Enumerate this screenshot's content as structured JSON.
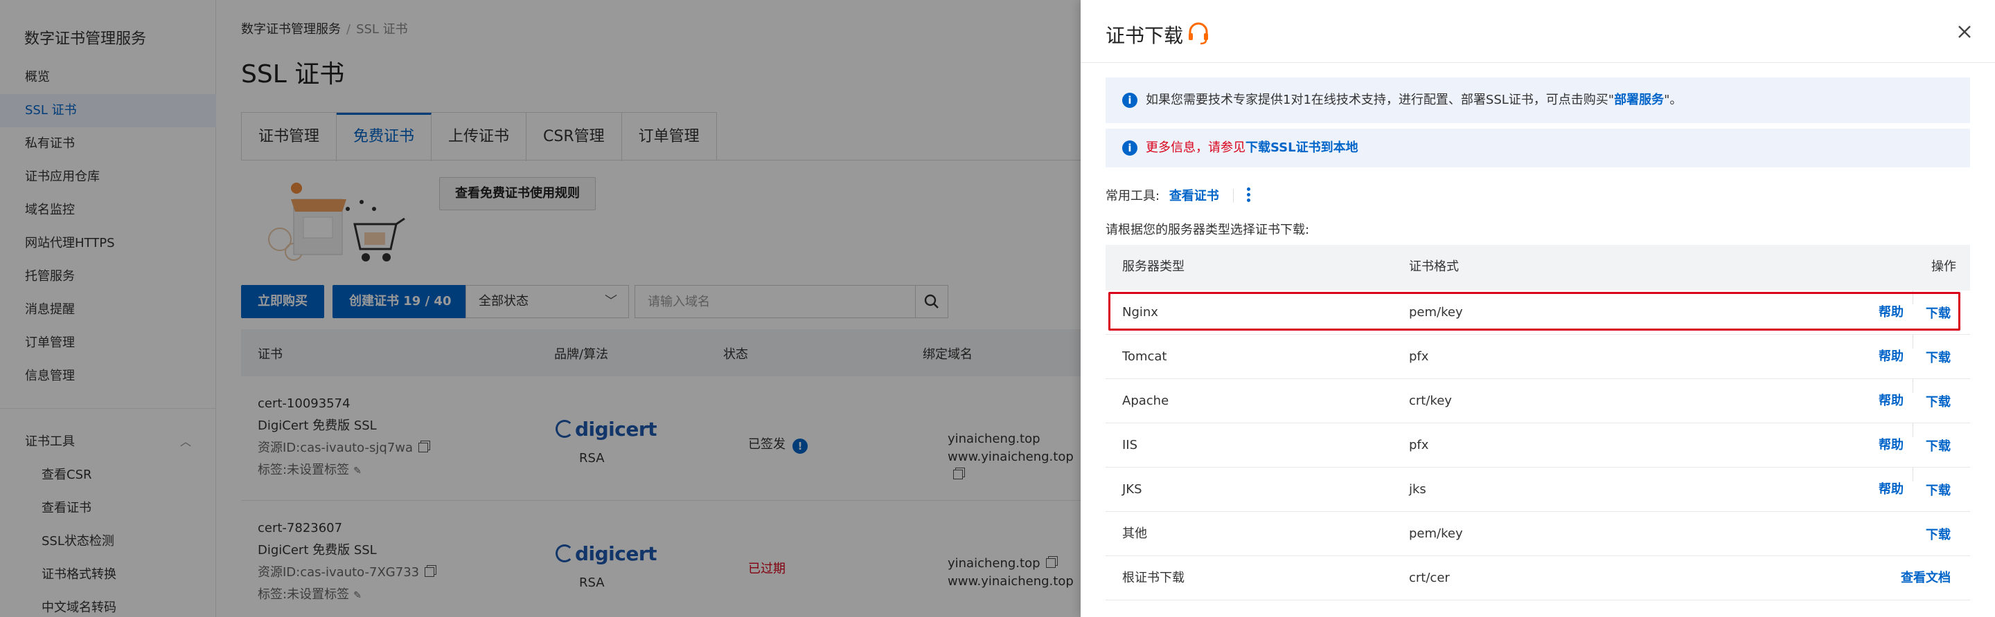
{
  "sidebar": {
    "title": "数字证书管理服务",
    "items": [
      "概览",
      "SSL 证书",
      "私有证书",
      "证书应用仓库",
      "域名监控",
      "网站代理HTTPS",
      "托管服务",
      "消息提醒",
      "订单管理",
      "信息管理"
    ],
    "active_index": 1,
    "group_label": "证书工具",
    "group_items": [
      "查看CSR",
      "查看证书",
      "SSL状态检测",
      "证书格式转换",
      "中文域名转码"
    ]
  },
  "main": {
    "breadcrumb": [
      "数字证书管理服务",
      "SSL 证书"
    ],
    "title": "SSL 证书",
    "tabs": [
      "证书管理",
      "免费证书",
      "上传证书",
      "CSR管理",
      "订单管理"
    ],
    "active_tab": 1,
    "rules_button": "查看免费证书使用规则",
    "buy_button": "立即购买",
    "create_button": "创建证书 19 / 40",
    "status_select": "全部状态",
    "search_placeholder": "请输入域名",
    "columns": [
      "证书",
      "品牌/算法",
      "状态",
      "绑定域名"
    ],
    "rows": [
      {
        "name": "cert-10093574",
        "product": "DigiCert 免费版 SSL",
        "resource_id": "资源ID:cas-ivauto-sjq7wa",
        "tag": "标签:未设置标签",
        "brand": "digicert",
        "algo": "RSA",
        "status": "已签发",
        "domain1": "yinaicheng.top",
        "domain2": "www.yinaicheng.top"
      },
      {
        "name": "cert-7823607",
        "product": "DigiCert 免费版 SSL",
        "resource_id": "资源ID:cas-ivauto-7XG733",
        "tag": "标签:未设置标签",
        "brand": "digicert",
        "algo": "RSA",
        "status": "已过期",
        "domain1": "yinaicheng.top",
        "domain2": "www.yinaicheng.top"
      }
    ]
  },
  "drawer": {
    "title": "证书下载",
    "notice1_prefix": "如果您需要技术专家提供1对1在线技术支持，进行配置、部署SSL证书，可点击购买\"",
    "notice1_link": "部署服务",
    "notice1_suffix": "\"。",
    "notice2_prefix": "更多信息，请参见",
    "notice2_link": "下载SSL证书到本地",
    "tools_label": "常用工具:",
    "tools_link": "查看证书",
    "hint": "请根据您的服务器类型选择证书下载:",
    "columns": [
      "服务器类型",
      "证书格式",
      "操作"
    ],
    "rows": [
      {
        "server": "Nginx",
        "format": "pem/key",
        "help": "帮助",
        "download": "下载"
      },
      {
        "server": "Tomcat",
        "format": "pfx",
        "help": "帮助",
        "download": "下载"
      },
      {
        "server": "Apache",
        "format": "crt/key",
        "help": "帮助",
        "download": "下载"
      },
      {
        "server": "IIS",
        "format": "pfx",
        "help": "帮助",
        "download": "下载"
      },
      {
        "server": "JKS",
        "format": "jks",
        "help": "帮助",
        "download": "下载"
      },
      {
        "server": "其他",
        "format": "pem/key",
        "help": "",
        "download": "下载"
      },
      {
        "server": "根证书下载",
        "format": "crt/cer",
        "help": "",
        "download": "查看文档"
      }
    ],
    "highlighted_row": 0
  },
  "colors": {
    "accent": "#0064c8",
    "danger": "#d9001b",
    "headset": "#ff6a00"
  }
}
